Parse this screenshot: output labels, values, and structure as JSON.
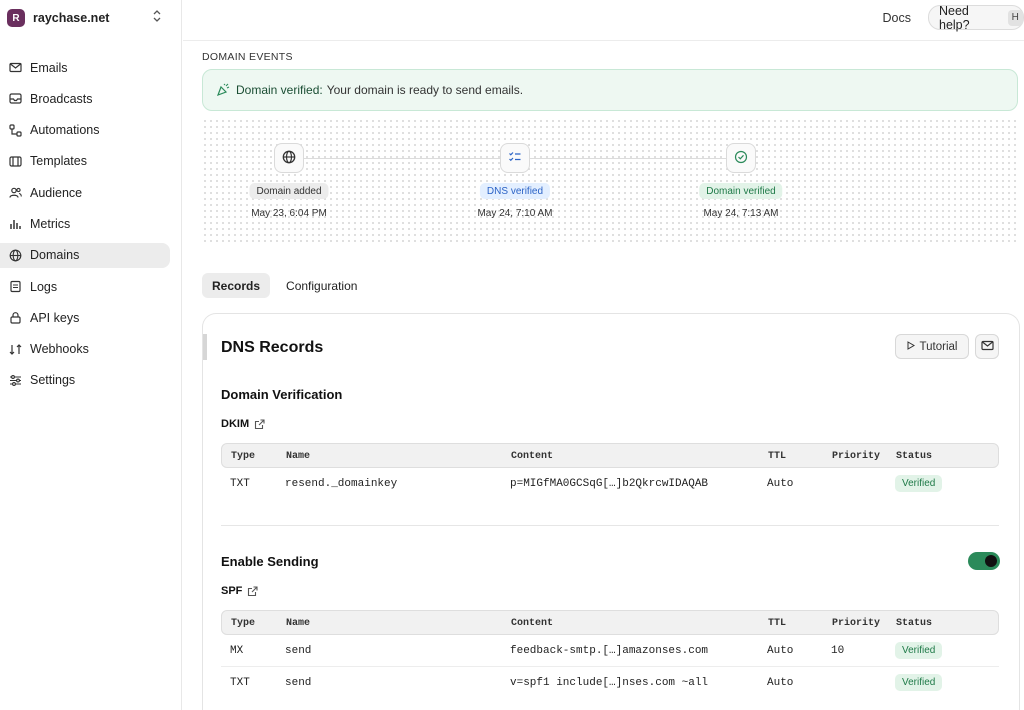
{
  "workspace": {
    "logo_letter": "R",
    "name": "raychase.net",
    "switch_icon": "chevrons-up-down-icon"
  },
  "sidebar": {
    "items": [
      {
        "label": "Emails",
        "icon": "mail-icon"
      },
      {
        "label": "Broadcasts",
        "icon": "inbox-icon"
      },
      {
        "label": "Automations",
        "icon": "automation-icon"
      },
      {
        "label": "Templates",
        "icon": "template-icon"
      },
      {
        "label": "Audience",
        "icon": "users-icon"
      },
      {
        "label": "Metrics",
        "icon": "bar-chart-icon"
      },
      {
        "label": "Domains",
        "icon": "globe-icon",
        "active": true
      },
      {
        "label": "Logs",
        "icon": "file-icon"
      },
      {
        "label": "API keys",
        "icon": "lock-icon"
      },
      {
        "label": "Webhooks",
        "icon": "webhook-icon"
      },
      {
        "label": "Settings",
        "icon": "sliders-icon"
      }
    ]
  },
  "topbar": {
    "docs": "Docs",
    "help": "Need help?",
    "help_key": "H"
  },
  "domain_events": {
    "section_label": "DOMAIN EVENTS",
    "banner_title": "Domain verified:",
    "banner_message": "Your domain is ready to send emails.",
    "events": [
      {
        "label": "Domain added",
        "date": "May 23, 6:04 PM",
        "icon": "globe-icon",
        "style": "gray"
      },
      {
        "label": "DNS verified",
        "date": "May 24, 7:10 AM",
        "icon": "list-check-icon",
        "style": "blue"
      },
      {
        "label": "Domain verified",
        "date": "May 24, 7:13 AM",
        "icon": "check-circle-icon",
        "style": "green"
      }
    ]
  },
  "tabs": [
    {
      "label": "Records",
      "active": true
    },
    {
      "label": "Configuration"
    }
  ],
  "dns": {
    "title": "DNS Records",
    "tutorial": "Tutorial",
    "columns": [
      "Type",
      "Name",
      "Content",
      "TTL",
      "Priority",
      "Status"
    ],
    "verification": {
      "title": "Domain Verification",
      "record_label": "DKIM",
      "rows": [
        {
          "type": "TXT",
          "name": "resend._domainkey",
          "content": "p=MIGfMA0GCSqG[…]b2QkrcwIDAQAB",
          "ttl": "Auto",
          "priority": "",
          "status": "Verified"
        }
      ]
    },
    "sending": {
      "title": "Enable Sending",
      "enabled": true,
      "record_label": "SPF",
      "rows": [
        {
          "type": "MX",
          "name": "send",
          "content": "feedback-smtp.[…]amazonses.com",
          "ttl": "Auto",
          "priority": "10",
          "status": "Verified"
        },
        {
          "type": "TXT",
          "name": "send",
          "content": "v=spf1 include[…]nses.com ~all",
          "ttl": "Auto",
          "priority": "",
          "status": "Verified"
        }
      ]
    }
  },
  "colors": {
    "accent_green": "#2b8a5a",
    "badge_blue": "#2b63c6",
    "logo": "#6a2f5e"
  }
}
